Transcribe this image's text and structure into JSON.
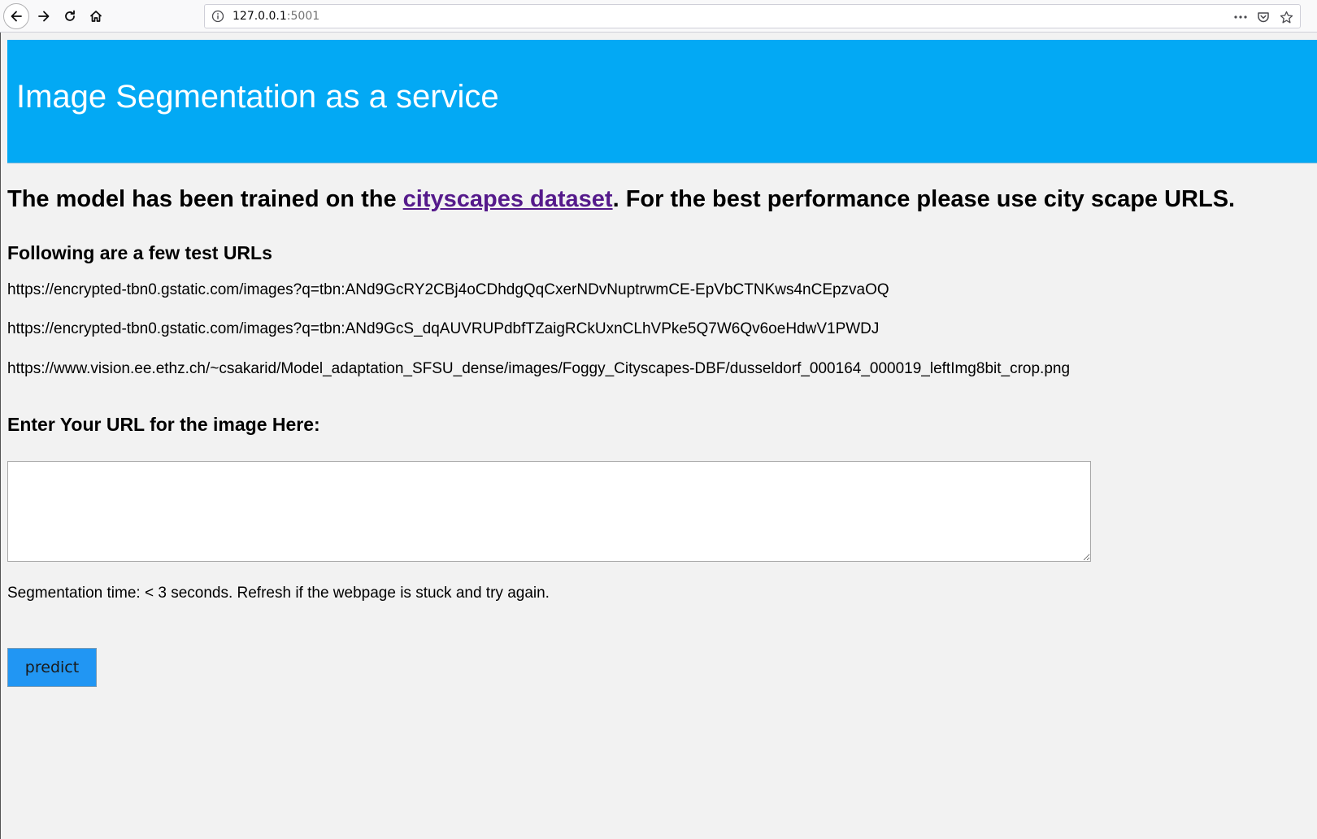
{
  "browser": {
    "url_host": "127.0.0.1",
    "url_port": ":5001",
    "icons": {
      "back": "back-arrow-icon",
      "forward": "forward-arrow-icon",
      "reload": "reload-icon",
      "home": "home-icon",
      "info": "info-icon",
      "more": "more-dots-icon",
      "pocket": "pocket-icon",
      "bookmark": "bookmark-star-icon"
    }
  },
  "header": {
    "title": "Image Segmentation as a service",
    "background": "#03a9f4"
  },
  "intro": {
    "before_link": "The model has been trained on the ",
    "link_text": "cityscapes dataset",
    "after_link": ". For the best performance please use city scape URLS."
  },
  "test_urls": {
    "heading": "Following are a few test URLs",
    "items": [
      "https://encrypted-tbn0.gstatic.com/images?q=tbn:ANd9GcRY2CBj4oCDhdgQqCxerNDvNuptrwmCE-EpVbCTNKws4nCEpzvaOQ",
      "https://encrypted-tbn0.gstatic.com/images?q=tbn:ANd9GcS_dqAUVRUPdbfTZaigRCkUxnCLhVPke5Q7W6Qv6oeHdwV1PWDJ",
      "https://www.vision.ee.ethz.ch/~csakarid/Model_adaptation_SFSU_dense/images/Foggy_Cityscapes-DBF/dusseldorf_000164_000019_leftImg8bit_crop.png"
    ]
  },
  "form": {
    "heading": "Enter Your URL for the image Here:",
    "url_value": "",
    "note": "Segmentation time: < 3 seconds. Refresh if the webpage is stuck and try again.",
    "predict_label": "predict",
    "button_color": "#2196f3"
  }
}
